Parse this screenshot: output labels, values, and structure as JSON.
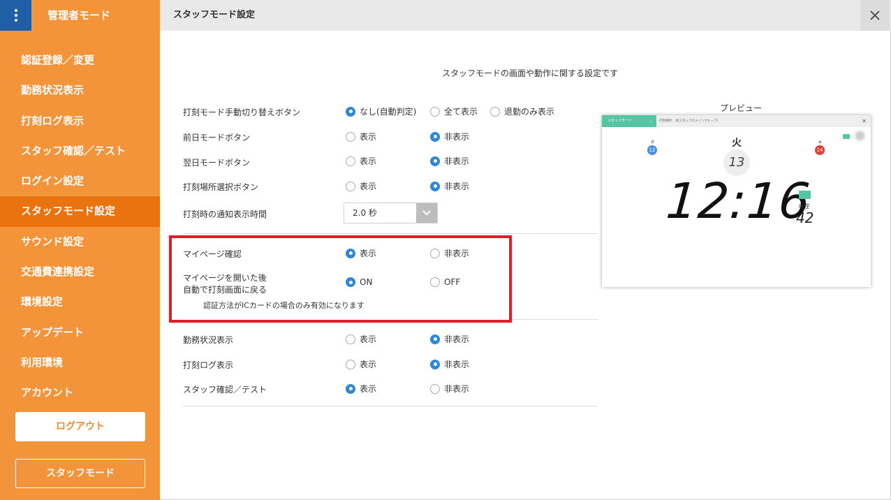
{
  "sidebar": {
    "title": "管理者モード",
    "items": [
      {
        "label": "認証登録／変更"
      },
      {
        "label": "勤務状況表示"
      },
      {
        "label": "打刻ログ表示"
      },
      {
        "label": "スタッフ確認／テスト"
      },
      {
        "label": "ログイン設定"
      },
      {
        "label": "スタッフモード設定"
      },
      {
        "label": "サウンド設定"
      },
      {
        "label": "交通費連携設定"
      },
      {
        "label": "環境設定"
      },
      {
        "label": "アップデート"
      },
      {
        "label": "利用環境"
      },
      {
        "label": "アカウント"
      }
    ],
    "active_index": 5,
    "logout_label": "ログアウト",
    "staff_mode_label": "スタッフモード"
  },
  "header": {
    "title": "スタッフモード設定"
  },
  "main": {
    "description": "スタッフモードの画面や動作に関する設定です",
    "rows": {
      "mode_switch": {
        "label": "打刻モード手動切り替えボタン",
        "options": [
          "なし(自動判定)",
          "全て表示",
          "退勤のみ表示"
        ],
        "selected": 0
      },
      "prev_day": {
        "label": "前日モードボタン",
        "options": [
          "表示",
          "非表示"
        ],
        "selected": 1
      },
      "next_day": {
        "label": "翌日モードボタン",
        "options": [
          "表示",
          "非表示"
        ],
        "selected": 1
      },
      "location": {
        "label": "打刻場所選択ボタン",
        "options": [
          "表示",
          "非表示"
        ],
        "selected": 1
      },
      "notify_time": {
        "label": "打刻時の通知表示時間",
        "value": "2.0 秒"
      },
      "mypage": {
        "label": "マイページ確認",
        "options": [
          "表示",
          "非表示"
        ],
        "selected": 0
      },
      "mypage_return": {
        "label_line1": "マイページを開いた後",
        "label_line2": "自動で打刻画面に戻る",
        "options": [
          "ON",
          "OFF"
        ],
        "selected": 0,
        "note": "認証方法がICカードの場合のみ有効になります"
      },
      "work_status": {
        "label": "勤務状況表示",
        "options": [
          "表示",
          "非表示"
        ],
        "selected": 1
      },
      "punch_log": {
        "label": "打刻ログ表示",
        "options": [
          "表示",
          "非表示"
        ],
        "selected": 1
      },
      "staff_check": {
        "label": "スタッフ確認／テスト",
        "options": [
          "表示",
          "非表示"
        ],
        "selected": 0
      }
    }
  },
  "preview": {
    "label": "プレビュー",
    "mode_label": "スタッフモード",
    "location_text": "打刻場所：(名スタッフのメイングループ)",
    "prev_day_name": "月",
    "prev_day_num": "12",
    "today_name": "火",
    "today_num": "13",
    "next_day_name": "水",
    "next_day_num": "14",
    "time": "12:16",
    "now_label": "現在",
    "seconds": "42",
    "colors": {
      "prev_day": "#4f8fdb",
      "next_day": "#e0423a",
      "accent": "#54c6a3"
    }
  },
  "colors": {
    "sidebar": "#f3933a",
    "sidebar_active": "#e8730f",
    "menu_button": "#1f5fa6",
    "radio_on": "#2f87d6",
    "highlight": "#e21d2a"
  }
}
